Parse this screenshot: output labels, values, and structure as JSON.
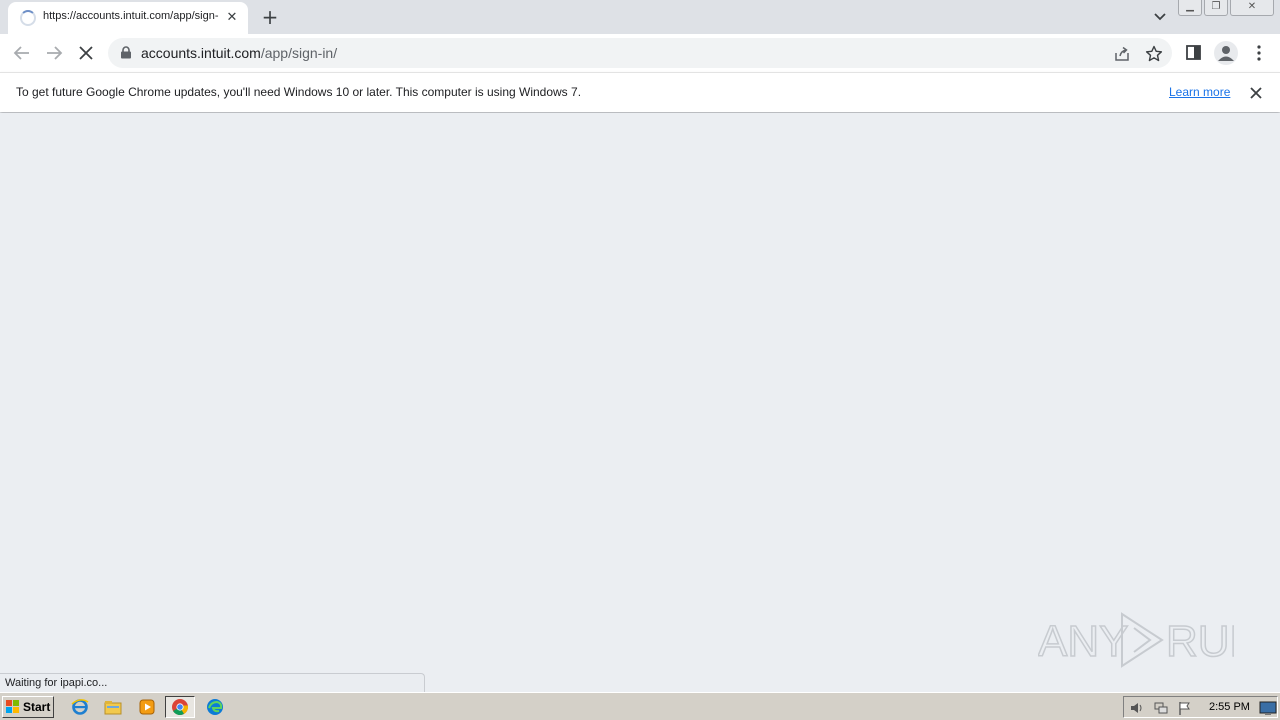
{
  "browser": {
    "tab": {
      "title": "https://accounts.intuit.com/app/sign-in/",
      "loading": true
    },
    "url": {
      "host": "accounts.intuit.com",
      "path": "/app/sign-in/"
    }
  },
  "infobar": {
    "message": "To get future Google Chrome updates, you'll need Windows 10 or later. This computer is using Windows 7.",
    "link_label": "Learn more"
  },
  "status_text": "Waiting for ipapi.co...",
  "watermark": "ANY RUN",
  "taskbar": {
    "start_label": "Start",
    "apps": [
      "internet-explorer",
      "file-explorer",
      "media-player",
      "chrome",
      "edge"
    ],
    "clock": "2:55 PM"
  },
  "colors": {
    "page_background": "#ebeef2",
    "link": "#1a73e8",
    "tab_strip": "#dee1e6"
  }
}
